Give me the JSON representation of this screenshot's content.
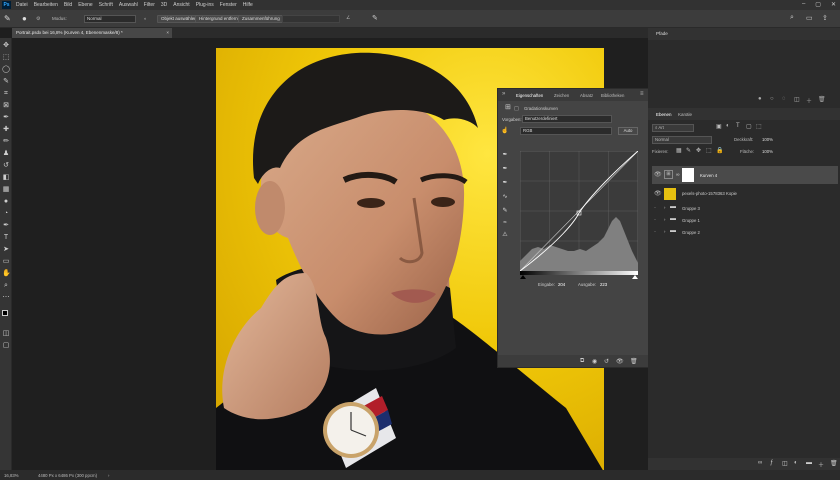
{
  "menubar": {
    "logo": "Ps",
    "items": [
      "Datei",
      "Bearbeiten",
      "Bild",
      "Ebene",
      "Schrift",
      "Auswahl",
      "Filter",
      "3D",
      "Ansicht",
      "Plug-ins",
      "Fenster",
      "Hilfe"
    ]
  },
  "optbar": {
    "modus_label": "Modus:",
    "modus_value": "Normal",
    "subject_button": "Objekt auswählen",
    "select_button": "Hintergrund entfernen",
    "approx_button": "Zusammenführung"
  },
  "document": {
    "tab_title": "Portrait.psdx bei 16,8% (Kurven 4, Ebenenmaske/8) *"
  },
  "toolbar": {
    "icons": [
      "move-icon",
      "marquee-icon",
      "lasso-icon",
      "quick-select-icon",
      "crop-icon",
      "frame-icon",
      "eyedropper-icon",
      "healing-icon",
      "brush-icon",
      "stamp-icon",
      "history-brush-icon",
      "eraser-icon",
      "gradient-icon",
      "blur-icon",
      "dodge-icon",
      "pen-icon",
      "type-icon",
      "path-select-icon",
      "shape-icon",
      "hand-icon",
      "zoom-icon",
      "more-icon"
    ]
  },
  "properties": {
    "tab_properties": "Eigenschaften",
    "tab_characters": "Zeichen",
    "tab_absatz": "Absatz",
    "tab_library": "Bibliotheken",
    "section_title": "Gradationskurven",
    "preset_label": "Vorgaben:",
    "preset_value": "Benutzerdefiniert",
    "channel_value": "RGB",
    "auto_button": "Auto",
    "input_label": "Eingabe:",
    "input_value": "204",
    "output_label": "Ausgabe:",
    "output_value": "223"
  },
  "dock": {
    "paths_tab": "Pfade",
    "layers_tab": "Ebenen",
    "channels_tab": "Kanäle",
    "filter_value": "Art",
    "blend_mode": "Normal",
    "opacity_label": "Deckkraft:",
    "opacity_value": "100%",
    "fill_label": "Fläche:",
    "fill_value": "100%",
    "lock_label": "Fixieren:",
    "layers": [
      {
        "name": "Kurven 4"
      },
      {
        "name": "pexels-photo-1578363 Kopie"
      },
      {
        "name": "Gruppe 3"
      },
      {
        "name": "Gruppe 1"
      },
      {
        "name": "Gruppe 2"
      }
    ]
  },
  "status": {
    "zoom": "16,83%",
    "size": "4480 Px x 6486 Px (300 ppcm)"
  },
  "colors": {
    "accent": "#31a8ff",
    "background_yellow": "#f2cc0a"
  }
}
